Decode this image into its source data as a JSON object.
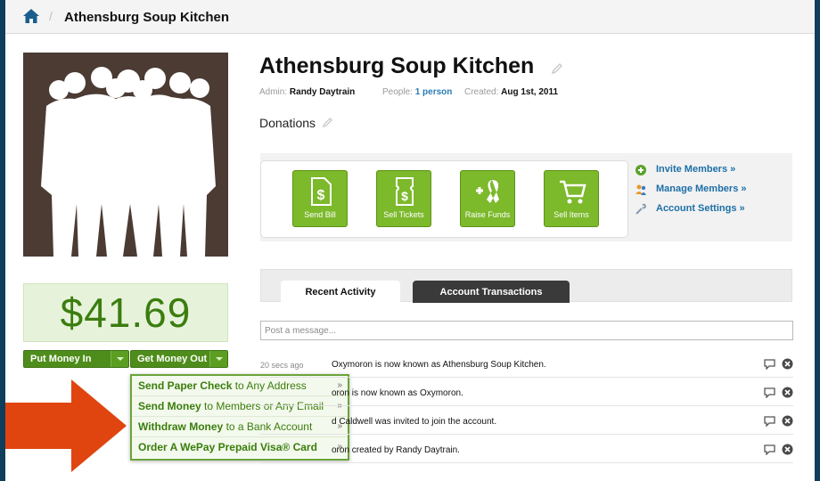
{
  "breadcrumb": {
    "separator": "/",
    "title": "Athensburg Soup Kitchen"
  },
  "account": {
    "name": "Athensburg Soup Kitchen",
    "admin_label": "Admin:",
    "admin_value": "Randy Daytrain",
    "people_label": "People:",
    "people_value": "1 person",
    "created_label": "Created:",
    "created_value": "Aug 1st, 2011",
    "description": "Donations"
  },
  "balance": "$41.69",
  "buttons": {
    "put_money_in": "Put Money In",
    "get_money_out": "Get Money Out"
  },
  "dropdown": [
    {
      "strong": "Send Paper Check",
      "rest": " to Any Address",
      "arrow": "»"
    },
    {
      "strong": "Send Money",
      "rest": " to Members or Any Email",
      "arrow": "»"
    },
    {
      "strong": "Withdraw Money",
      "rest": " to a Bank Account",
      "arrow": "»"
    },
    {
      "strong": "Order A WePay Prepaid Visa® Card",
      "rest": "",
      "arrow": "»"
    }
  ],
  "actions": [
    {
      "label": "Send Bill",
      "icon": "send-bill-icon"
    },
    {
      "label": "Sell Tickets",
      "icon": "ticket-icon"
    },
    {
      "label": "Raise Funds",
      "icon": "ribbon-icon"
    },
    {
      "label": "Sell Items",
      "icon": "cart-icon"
    }
  ],
  "side_links": [
    {
      "label": "Invite Members »",
      "icon": "plus-circle-icon"
    },
    {
      "label": "Manage Members »",
      "icon": "members-icon"
    },
    {
      "label": "Account Settings »",
      "icon": "wrench-icon"
    }
  ],
  "tabs": {
    "recent": "Recent Activity",
    "transactions": "Account Transactions"
  },
  "post": {
    "placeholder": "Post a message..."
  },
  "feed": [
    {
      "time": "20 secs ago",
      "message": "Oxymoron is now known as Athensburg Soup Kitchen."
    },
    {
      "time": "",
      "message": "oron is now known as Oxymoron."
    },
    {
      "time": "",
      "message": "d Caldwell was invited to join the account."
    },
    {
      "time": "",
      "message": "oron created by Randy Daytrain."
    }
  ],
  "colors": {
    "brand_green": "#4e8d1b",
    "tile_green": "#7cb92b",
    "link_blue": "#1c6fa6",
    "balance_green": "#3b7d0f",
    "arrow_red": "#e0450f"
  }
}
